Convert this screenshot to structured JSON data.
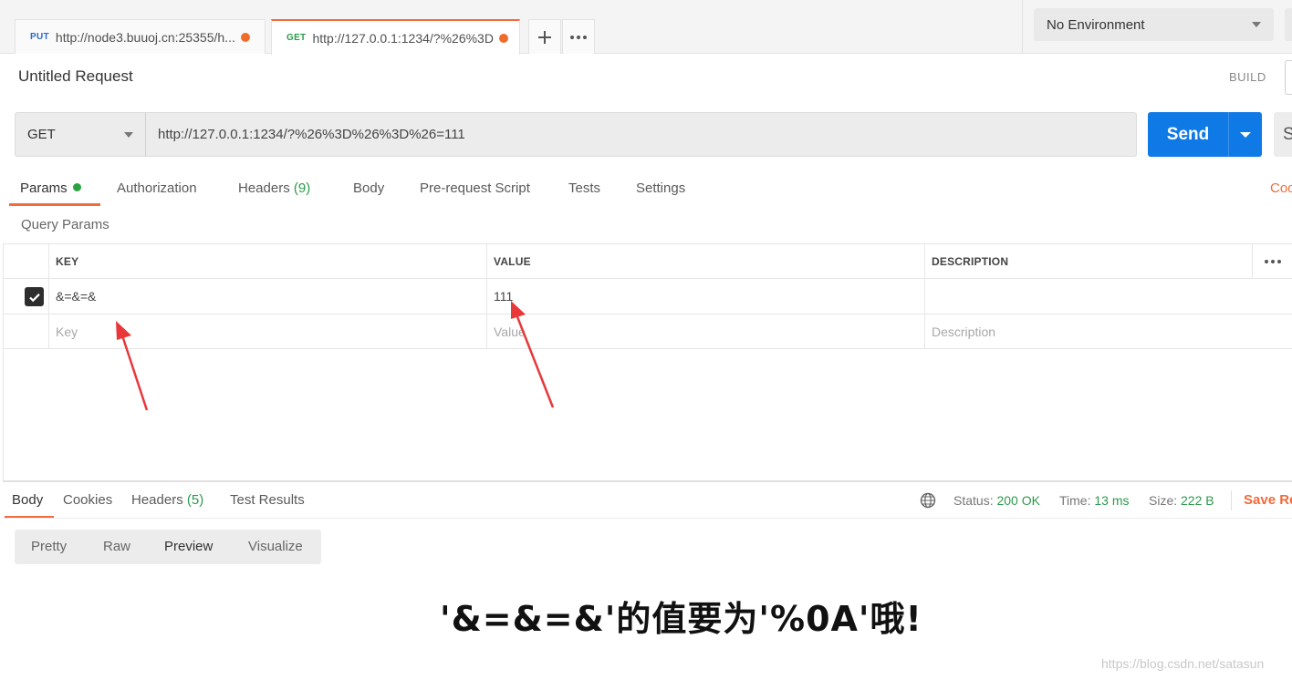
{
  "tabs": [
    {
      "method": "PUT",
      "url": "http://node3.buuoj.cn:25355/h..."
    },
    {
      "method": "GET",
      "url": "http://127.0.0.1:1234/?%26%3D..."
    }
  ],
  "environment": {
    "selected": "No Environment"
  },
  "request": {
    "title": "Untitled Request",
    "build_label": "BUILD",
    "method": "GET",
    "url": "http://127.0.0.1:1234/?%26%3D%26%3D%26=111",
    "send_label": "Send",
    "save_label": "S"
  },
  "request_tabs": {
    "params": "Params",
    "authorization": "Authorization",
    "headers": "Headers",
    "headers_count": "(9)",
    "body": "Body",
    "prerequest": "Pre-request Script",
    "tests": "Tests",
    "settings": "Settings",
    "code": "Coo"
  },
  "query_params": {
    "title": "Query Params",
    "columns": {
      "key": "KEY",
      "value": "VALUE",
      "description": "DESCRIPTION"
    },
    "rows": [
      {
        "key": "&=&=&",
        "value": "111",
        "description": "",
        "checked": true
      }
    ],
    "placeholders": {
      "key": "Key",
      "value": "Value",
      "description": "Description"
    }
  },
  "response": {
    "tabs": {
      "body": "Body",
      "cookies": "Cookies",
      "headers": "Headers",
      "headers_count": "(5)",
      "test_results": "Test Results"
    },
    "status_label": "Status:",
    "status_value": "200 OK",
    "time_label": "Time:",
    "time_value": "13 ms",
    "size_label": "Size:",
    "size_value": "222 B",
    "save_label": "Save Re",
    "views": [
      "Pretty",
      "Raw",
      "Preview",
      "Visualize"
    ],
    "preview_text": "'&=&=&'的值要为'%0A'哦!"
  },
  "watermark": "https://blog.csdn.net/satasun",
  "colors": {
    "accent": "#f26b3a",
    "send": "#0f7ae5",
    "success": "#2b9a4b"
  }
}
